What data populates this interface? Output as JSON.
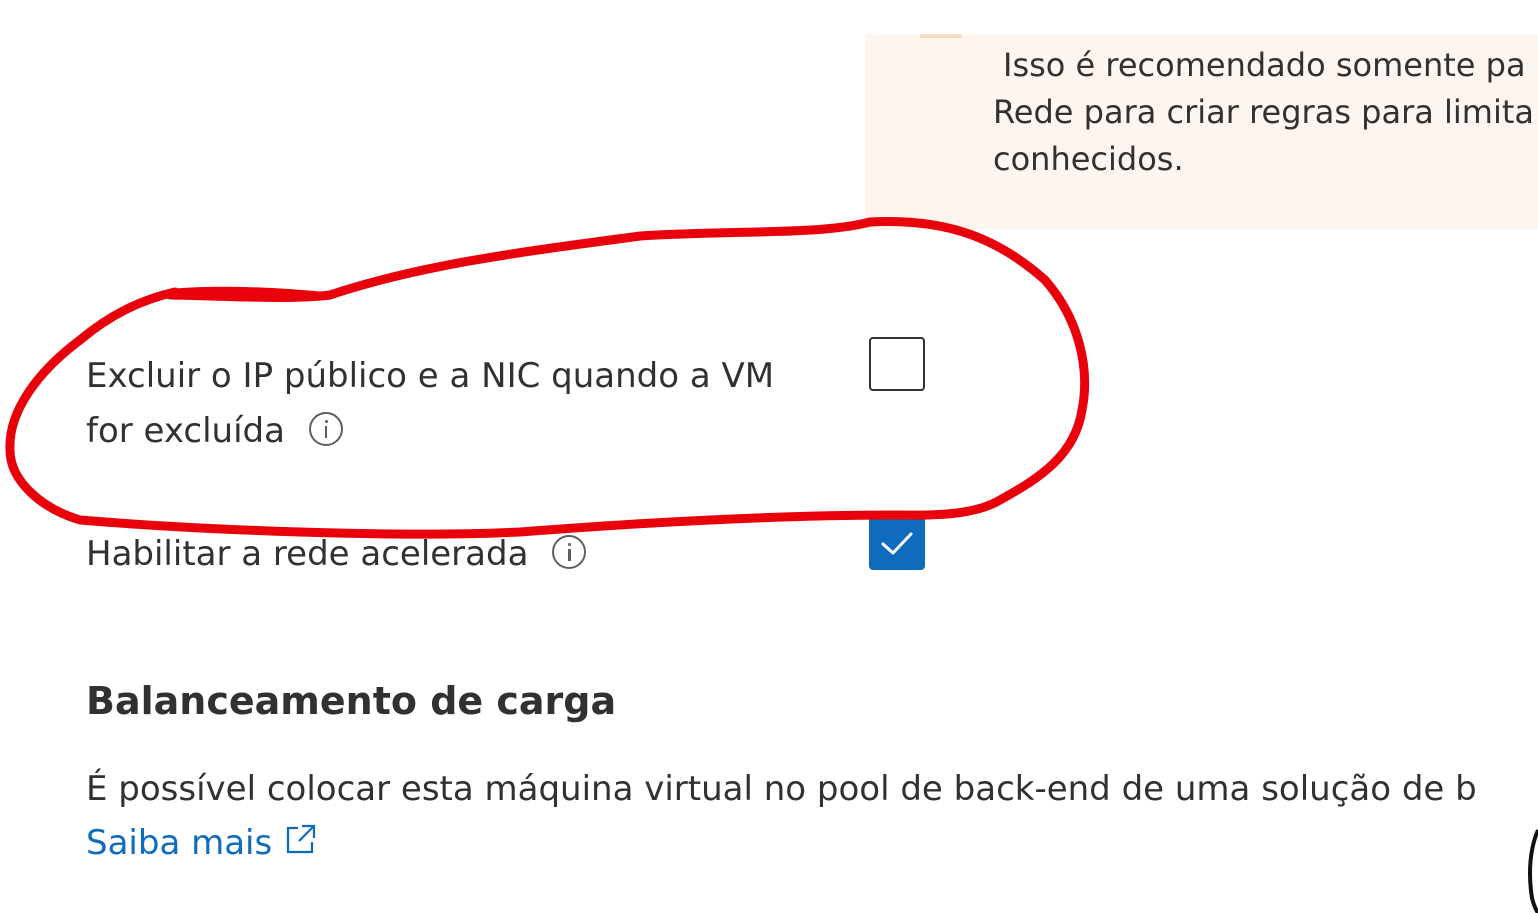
{
  "warning": {
    "line1": "Isso é recomendado somente pa",
    "line2": "Rede para criar regras para limita",
    "line3": "conhecidos."
  },
  "options": [
    {
      "label_line1": "Excluir o IP público e a NIC quando a VM",
      "label_line2": "for excluída",
      "checked": false,
      "info_icon": "info-icon"
    },
    {
      "label": "Habilitar a rede acelerada",
      "checked": true,
      "info_icon": "info-icon"
    }
  ],
  "load_balancing": {
    "heading": "Balanceamento de carga",
    "description": "É possível colocar esta máquina virtual no pool de back-end de uma solução de b",
    "learn_more": "Saiba mais",
    "learn_more_icon": "external-link-icon"
  },
  "colors": {
    "accent": "#0f6cbd",
    "annotation": "#e8000b",
    "warning_background": "#fdf6f0",
    "text": "#323130"
  }
}
